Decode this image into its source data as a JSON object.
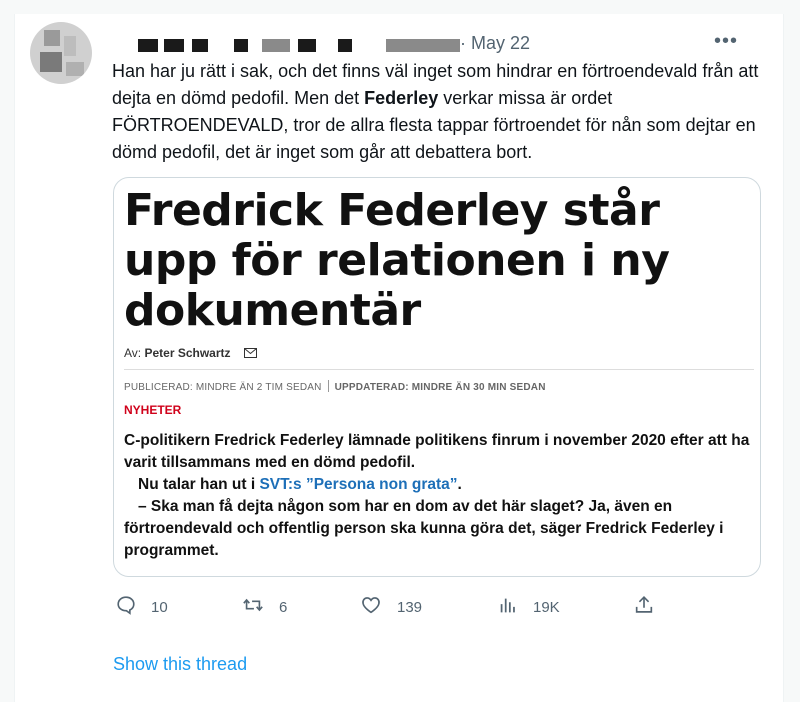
{
  "tweet": {
    "date": "· May 22",
    "more_label": "•••",
    "text_part1": "Han har ju rätt i sak, och det finns väl inget som hindrar en förtroendevald från att dejta en dömd pedofil. Men det ",
    "text_bold": "Federley",
    "text_part2": " verkar missa är ordet FÖRTROENDEVALD, tror de allra flesta tappar förtroendet för nån som dejtar en dömd pedofil, det är inget som går att debattera bort."
  },
  "article": {
    "headline": "Fredrick Federley står upp för relationen i ny dokumentär",
    "byline_prefix": "Av: ",
    "byline_author": "Peter Schwartz",
    "published": "PUBLICERAD: MINDRE ÄN 2 TIM SEDAN",
    "updated": "UPPDATERAD: MINDRE ÄN 30 MIN SEDAN",
    "category": "NYHETER",
    "paragraph1": "C-politikern Fredrick Federley lämnade politikens finrum i november 2020 efter att ha varit tillsammans med en dömd pedofil.",
    "paragraph2_prefix": "Nu talar han ut i ",
    "paragraph2_link": "SVT:s ”Persona non grata”",
    "paragraph2_suffix": ".",
    "paragraph3": "– Ska man få dejta någon som har en dom av det här slaget? Ja, även en förtroendevald och offentlig person ska kunna göra det, säger Fredrick Federley i programmet."
  },
  "actions": {
    "reply_count": "10",
    "retweet_count": "6",
    "like_count": "139",
    "views_count": "19K"
  },
  "icons": [
    "reply-icon",
    "retweet-icon",
    "like-icon",
    "views-icon",
    "share-icon",
    "mail-icon",
    "more-icon"
  ],
  "show_thread": "Show this thread",
  "colors": {
    "link_blue": "#1d9bf0",
    "muted_gray": "#536471",
    "category_red": "#d0021b",
    "article_link": "#1d6fb8"
  }
}
